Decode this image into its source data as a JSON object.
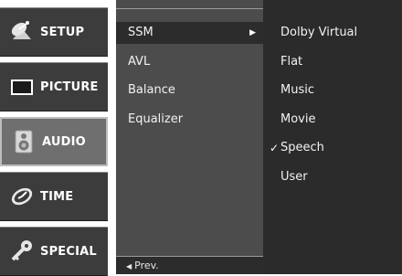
{
  "categories": [
    {
      "label": "SETUP",
      "icon": "satellite-dish-icon"
    },
    {
      "label": "PICTURE",
      "icon": "tv-screen-icon"
    },
    {
      "label": "AUDIO",
      "icon": "speaker-icon",
      "selected": true
    },
    {
      "label": "TIME",
      "icon": "clock-icon"
    },
    {
      "label": "SPECIAL",
      "icon": "key-icon"
    }
  ],
  "submenu": {
    "items": [
      {
        "label": "SSM",
        "selected": true,
        "arrow": "▶"
      },
      {
        "label": "AVL"
      },
      {
        "label": "Balance"
      },
      {
        "label": "Equalizer"
      }
    ],
    "prev_label": "Prev.",
    "prev_arrow": "◀"
  },
  "options": {
    "items": [
      {
        "label": "Dolby Virtual"
      },
      {
        "label": "Flat"
      },
      {
        "label": "Music"
      },
      {
        "label": "Movie"
      },
      {
        "label": "Speech",
        "checked": true,
        "check_mark": "✓"
      },
      {
        "label": "User"
      }
    ]
  },
  "colors": {
    "category_bg": "#3c3c3c",
    "category_selected_bg": "#6f6f6f",
    "submenu_bg": "#4c4c4c",
    "options_bg": "#2b2b2b",
    "text": "#f2f2f2"
  }
}
